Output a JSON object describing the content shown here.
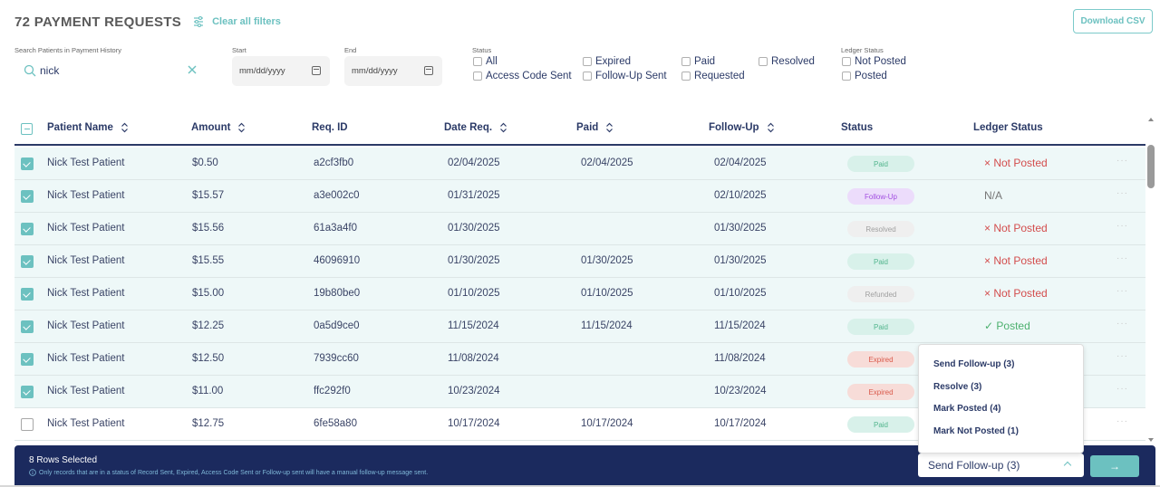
{
  "header": {
    "title": "72 PAYMENT REQUESTS",
    "filter_icon": "sliders-icon",
    "clear_filters": "Clear all filters",
    "download_csv": "Download CSV"
  },
  "filters": {
    "search": {
      "label": "Search Patients in Payment History",
      "value": "nick",
      "icon": "search-icon",
      "clear_icon": "close-icon"
    },
    "start": {
      "label": "Start",
      "placeholder": "mm/dd/yyyy",
      "icon": "calendar-icon"
    },
    "end": {
      "label": "End",
      "placeholder": "mm/dd/yyyy",
      "icon": "calendar-icon"
    },
    "status": {
      "label": "Status",
      "options": [
        {
          "label": "All",
          "checked": false
        },
        {
          "label": "Access Code Sent",
          "checked": false
        },
        {
          "label": "Expired",
          "checked": false
        },
        {
          "label": "Follow-Up Sent",
          "checked": false
        },
        {
          "label": "Paid",
          "checked": false
        },
        {
          "label": "Requested",
          "checked": false
        },
        {
          "label": "Resolved",
          "checked": false
        }
      ]
    },
    "ledger_status": {
      "label": "Ledger Status",
      "options": [
        {
          "label": "Not Posted",
          "checked": false
        },
        {
          "label": "Posted",
          "checked": false
        }
      ]
    }
  },
  "table": {
    "select_all_state": "indeterminate",
    "columns": [
      {
        "label": "Patient Name",
        "sortable": true
      },
      {
        "label": "Amount",
        "sortable": true
      },
      {
        "label": "Req. ID",
        "sortable": false
      },
      {
        "label": "Date Req.",
        "sortable": true
      },
      {
        "label": "Paid",
        "sortable": true
      },
      {
        "label": "Follow-Up",
        "sortable": true
      },
      {
        "label": "Status",
        "sortable": false
      },
      {
        "label": "Ledger Status",
        "sortable": false
      }
    ],
    "rows": [
      {
        "selected": true,
        "patient": "Nick Test Patient",
        "amount": "$0.50",
        "req_id": "a2cf3fb0",
        "date_req": "02/04/2025",
        "paid": "02/04/2025",
        "follow_up": "02/04/2025",
        "status": "Paid",
        "ledger": "× Not Posted",
        "ledger_type": "not"
      },
      {
        "selected": true,
        "patient": "Nick Test Patient",
        "amount": "$15.57",
        "req_id": "a3e002c0",
        "date_req": "01/31/2025",
        "paid": "",
        "follow_up": "02/10/2025",
        "status": "Follow-Up",
        "ledger": "N/A",
        "ledger_type": "na"
      },
      {
        "selected": true,
        "patient": "Nick Test Patient",
        "amount": "$15.56",
        "req_id": "61a3a4f0",
        "date_req": "01/30/2025",
        "paid": "",
        "follow_up": "01/30/2025",
        "status": "Resolved",
        "ledger": "× Not Posted",
        "ledger_type": "not"
      },
      {
        "selected": true,
        "patient": "Nick Test Patient",
        "amount": "$15.55",
        "req_id": "46096910",
        "date_req": "01/30/2025",
        "paid": "01/30/2025",
        "follow_up": "01/30/2025",
        "status": "Paid",
        "ledger": "× Not Posted",
        "ledger_type": "not"
      },
      {
        "selected": true,
        "patient": "Nick Test Patient",
        "amount": "$15.00",
        "req_id": "19b80be0",
        "date_req": "01/10/2025",
        "paid": "01/10/2025",
        "follow_up": "01/10/2025",
        "status": "Refunded",
        "ledger": "× Not Posted",
        "ledger_type": "not"
      },
      {
        "selected": true,
        "patient": "Nick Test Patient",
        "amount": "$12.25",
        "req_id": "0a5d9ce0",
        "date_req": "11/15/2024",
        "paid": "11/15/2024",
        "follow_up": "11/15/2024",
        "status": "Paid",
        "ledger": "✓ Posted",
        "ledger_type": "yes"
      },
      {
        "selected": true,
        "patient": "Nick Test Patient",
        "amount": "$12.50",
        "req_id": "7939cc60",
        "date_req": "11/08/2024",
        "paid": "",
        "follow_up": "11/08/2024",
        "status": "Expired",
        "ledger": "",
        "ledger_type": ""
      },
      {
        "selected": true,
        "patient": "Nick Test Patient",
        "amount": "$11.00",
        "req_id": "ffc292f0",
        "date_req": "10/23/2024",
        "paid": "",
        "follow_up": "10/23/2024",
        "status": "Expired",
        "ledger": "",
        "ledger_type": ""
      },
      {
        "selected": false,
        "patient": "Nick Test Patient",
        "amount": "$12.75",
        "req_id": "6fe58a80",
        "date_req": "10/17/2024",
        "paid": "10/17/2024",
        "follow_up": "10/17/2024",
        "status": "Paid",
        "ledger": "",
        "ledger_type": ""
      }
    ],
    "row_menu_label": "···"
  },
  "status_colors": {
    "Paid": {
      "bg": "#d8f1ea",
      "fg": "#52b58d"
    },
    "Follow-Up": {
      "bg": "#ecdcfb",
      "fg": "#a24fe0"
    },
    "Resolved": {
      "bg": "#efefef",
      "fg": "#a0a0a0"
    },
    "Refunded": {
      "bg": "#efefef",
      "fg": "#a0a0a0"
    },
    "Expired": {
      "bg": "#f7dcd8",
      "fg": "#d9594a"
    }
  },
  "footer": {
    "selected_count": "8 Rows Selected",
    "note": "Only records that are in a status of Record Sent, Expired, Access Code Sent or Follow-up sent will have a manual follow-up message sent.",
    "action_selected": "Send Follow-up (3)",
    "go_label": "→"
  },
  "action_menu": {
    "items": [
      "Send Follow-up (3)",
      "Resolve (3)",
      "Mark Posted (4)",
      "Mark Not Posted (1)"
    ]
  },
  "colors": {
    "accent": "#6cc1c0",
    "navy": "#1b2a5e",
    "text": "#2b3a67",
    "selected_row": "#eef8f8"
  }
}
